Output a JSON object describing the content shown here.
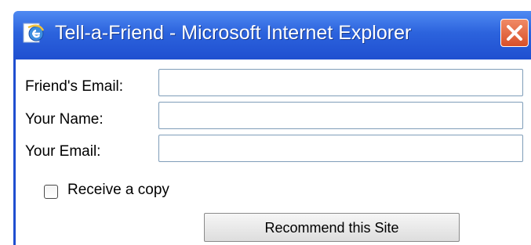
{
  "window": {
    "title": "Tell-a-Friend - Microsoft Internet Explorer"
  },
  "form": {
    "friend_email_label": "Friend's Email:",
    "friend_email_value": "",
    "your_name_label": "Your Name:",
    "your_name_value": "",
    "your_email_label": "Your Email:",
    "your_email_value": "",
    "copy_checkbox_label": "Receive a copy",
    "copy_checkbox_checked": false,
    "submit_label": "Recommend this Site"
  },
  "colors": {
    "titlebar": "#2c63dd",
    "close_button": "#d8502a",
    "field_border": "#7f9db9"
  },
  "icons": {
    "app": "internet-explorer-icon",
    "close": "close-icon"
  }
}
